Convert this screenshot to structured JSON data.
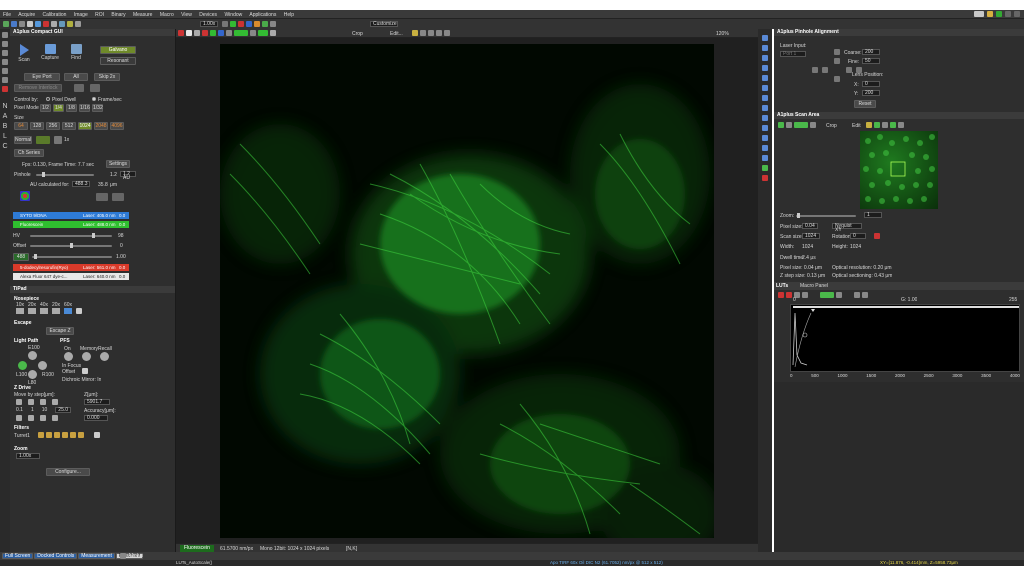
{
  "menu": [
    "File",
    "Acquire",
    "Calibration",
    "Image",
    "ROI",
    "Binary",
    "Measure",
    "Macro",
    "View",
    "Devices",
    "Window",
    "Applications",
    "Help"
  ],
  "toolbar": {
    "zoom": "1.00x",
    "workspace": "Customize"
  },
  "left_tools": [
    "N",
    "A",
    "B",
    "L",
    "C"
  ],
  "compact_gui": {
    "title": "A1plus Compact GUI",
    "scan": "Scan",
    "capture": "Capture",
    "find": "Find",
    "galvano": "Galvano",
    "resonant": "Resonant",
    "eyeport": "Eye Port",
    "all": "All",
    "skip": "Skip 2x",
    "remove_interlock": "Remove Interlock",
    "control_by": "Control by:",
    "pixel_dwell": "Pixel Dwell",
    "frame_sec": "Frame/sec",
    "pixel_mode_label": "Pixel Mode",
    "pixel_modes": [
      "1/2",
      "1/4",
      "1/8",
      "1/16",
      "1/32"
    ],
    "size_label": "Size",
    "sizes": [
      "64",
      "128",
      "256",
      "512",
      "1024",
      "2048",
      "4096"
    ],
    "normal": "Normal",
    "onex": "1x",
    "ch_series": "Ch Series",
    "fps_text": "Fps: 0.130, Frame Time: 7.7 sec",
    "settings": "Settings",
    "pinhole": "Pinhole",
    "pinhole_val": "1.2",
    "pinhole_unit": "1.2 AU",
    "au_calc": "AU calculated for:",
    "au_val": "488.3",
    "um_val": "35.8",
    "um": "μm",
    "channels": [
      {
        "name": "SYTO 9/DNA",
        "laser": "Laser: 405.0 nm",
        "val": "0.0",
        "color": "#2e7bd6"
      },
      {
        "name": "Fluorescein",
        "laser": "Laser: 488.0 nm",
        "val": "0.0",
        "color": "#2fbf2f"
      }
    ],
    "hv_label": "HV",
    "hv_val": "98",
    "offset_label": "Offset",
    "offset_val": "0",
    "laser_val": "1.00",
    "laser_btn": "488",
    "channels2": [
      {
        "name": "5-dodecylresorufin(Ryo)",
        "laser": "Laser: 561.0 nm",
        "val": "0.0",
        "color": "#d93a2a"
      },
      {
        "name": "Alexa Fluor 647 dye-c...",
        "laser": "Laser: 640.0 nm",
        "val": "0.0",
        "color": "#e8e8e8"
      }
    ]
  },
  "tipad": {
    "title": "TiPad",
    "nosepiece": "Nosepiece",
    "objectives": [
      "10x",
      "20x",
      "40x",
      "20x",
      "60x"
    ],
    "escape": "Escape",
    "escape_btn": "Escape Z",
    "light_path": "Light Path",
    "pfs": "PFS",
    "lp_labels": [
      "E100",
      "L100",
      "R100",
      "L80"
    ],
    "pfs_labels": [
      "On",
      "Memory",
      "Recall"
    ],
    "in_focus": "In Focus",
    "offset": "Offset",
    "dichroic": "Dichroic Mirror: In",
    "zdrive": "Z Drive",
    "move_by": "Move by step[μm]:",
    "z_label": "Z[μm]:",
    "z_val": "5901.7",
    "steps": [
      "0.1",
      "1",
      "10",
      "25.0"
    ],
    "accuracy": "Accuracy[μm]:",
    "acc_val": "0.000",
    "filters": "Filters",
    "turret": "Turret1",
    "zoom": "Zoom",
    "zoom_val": "1.00x",
    "configure": "Configure..."
  },
  "image_toolbar": {
    "crop": "Crop",
    "edit": "Edit...",
    "zoom_pct": "120%"
  },
  "image_tab": "Fluorescein",
  "image_status": {
    "wavelength": "61.5700 nm/px",
    "info": "Mono 12bit: 1024 x 1024 pixels",
    "nk": "[N,K]"
  },
  "pinhole_align": {
    "title": "A1plus Pinhole Alignment",
    "laser_input": "Laser Input:",
    "port": "Port 1",
    "coarse": "Coarse:",
    "coarse_val": "200",
    "fine": "Fine:",
    "fine_val": "50",
    "lens_pos": "Lens Position:",
    "x": "X:",
    "x_val": "0",
    "y": "Y:",
    "y_val": "200",
    "reset": "Reset"
  },
  "scan_area": {
    "title": "A1plus Scan Area",
    "crop": "Crop",
    "edit": "Edit",
    "zoom": "Zoom:",
    "zoom_val": "1",
    "pixel_size": "Pixel size:",
    "pixel_val": "0.04",
    "pixel_sel": "Nyquist XY",
    "scan_size": "Scan size:",
    "scan_val": "1024",
    "rotation": "Rotation:",
    "rot_val": "0",
    "width": "Width:",
    "width_val": "1024",
    "height": "Height:",
    "height_val": "1024",
    "dwell": "Dwell time:",
    "dwell_val": "2.4 μs",
    "px_info": "Pixel size: 0.04 μm",
    "opt_res": "Optical resolution: 0.20 μm",
    "z_step": "Z step size: 0.13 μm",
    "opt_sec": "Optical sectioning: 0.43 μm"
  },
  "luts": {
    "tab1": "LUTs",
    "tab2": "Macro Panel",
    "gamma": "G: 1.00",
    "min": "0",
    "max": "255",
    "x_ticks": [
      "0",
      "500",
      "1000",
      "1500",
      "2000",
      "2500",
      "3000",
      "3500",
      "4000"
    ]
  },
  "bottom_tabs": [
    "Full Screen",
    "Docked Controls",
    "Measurement",
    "Resonant"
  ],
  "bottom_a1": "A1plus",
  "status": {
    "left": "LUTs_AutoScale()",
    "mid": "Apo TIRF 60x Oil DIC N2 (61.7052) nm/px @ 512 x 512)",
    "right": "XY=[11.876, -0.414]mm, Z=5958.73μm"
  },
  "colors": {
    "accent_green": "#2dd52d",
    "scan_green": "#9ad22e",
    "panel": "#2e2e2e"
  }
}
